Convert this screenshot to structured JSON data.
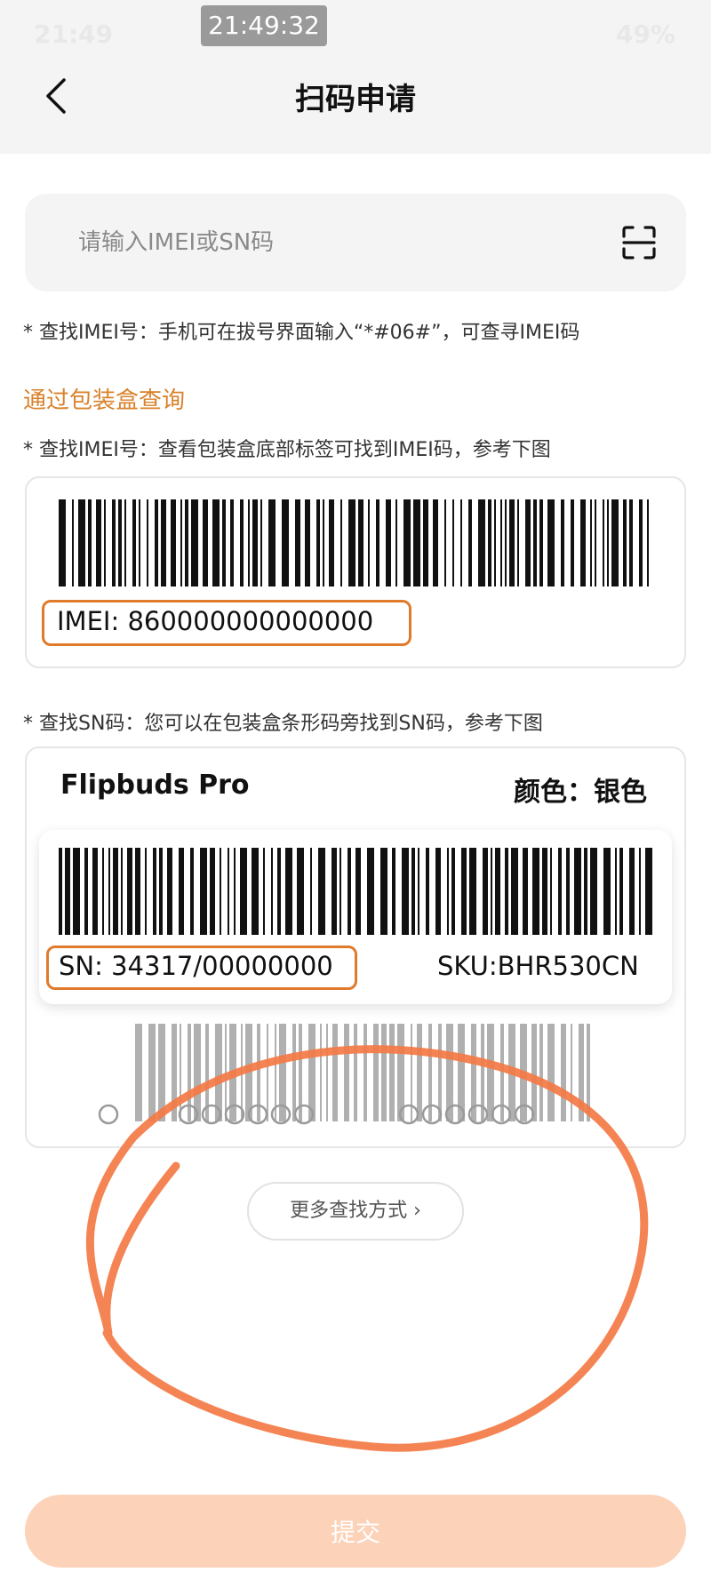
{
  "status_bar": {
    "time": "21:49",
    "time_overlay": "21:49:32",
    "battery": "49%"
  },
  "header": {
    "title": "扫码申请"
  },
  "search": {
    "placeholder": "请输入IMEI或SN码"
  },
  "hints": {
    "dial": "* 查找IMEI号：手机可在拔号界面输入“*#06#”，可查寻IMEI码",
    "box_section_title": "通过包装盒查询",
    "imei_box": "* 查找IMEI号：查看包装盒底部标签可找到IMEI码，参考下图",
    "sn_box": "* 查找SN码：您可以在包装盒条形码旁找到SN码，参考下图"
  },
  "imei_example": {
    "label": "IMEI: 860000000000000"
  },
  "sn_example": {
    "product": "Flipbuds Pro",
    "color": "颜色：银色",
    "sn": "SN: 34317/00000000",
    "sku": "SKU:BHR530CN"
  },
  "actions": {
    "more": "更多查找方式  ›",
    "submit": "提交"
  },
  "colors": {
    "accent": "#d9822b",
    "highlight_box": "#e07a2c",
    "annotation": "#f47a45",
    "submit_disabled": "#fcd2b8"
  }
}
